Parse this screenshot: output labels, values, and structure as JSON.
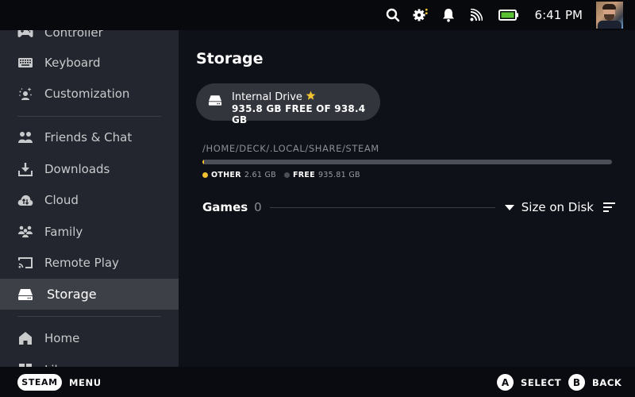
{
  "topbar": {
    "icons": [
      "search-icon",
      "settings-icon",
      "notifications-bell-icon",
      "network-signal-icon",
      "battery-icon"
    ],
    "time": "6:41 PM",
    "battery_level_percent": 100,
    "colors": {
      "battery": "#5bc236",
      "settings_badge": "#f1c232"
    }
  },
  "sidebar": {
    "items": [
      {
        "label": "Controller",
        "icon": "controller-icon"
      },
      {
        "label": "Keyboard",
        "icon": "keyboard-icon"
      },
      {
        "label": "Customization",
        "icon": "customization-icon"
      },
      {
        "label": "Friends & Chat",
        "icon": "friends-icon"
      },
      {
        "label": "Downloads",
        "icon": "download-icon"
      },
      {
        "label": "Cloud",
        "icon": "cloud-icon"
      },
      {
        "label": "Family",
        "icon": "family-icon"
      },
      {
        "label": "Remote Play",
        "icon": "remote-play-icon"
      },
      {
        "label": "Storage",
        "icon": "storage-drive-icon",
        "active": true
      },
      {
        "label": "Home",
        "icon": "home-icon"
      },
      {
        "label": "Library",
        "icon": "library-icon"
      }
    ]
  },
  "main": {
    "title": "Storage",
    "drive": {
      "name": "Internal Drive",
      "default_star": true,
      "free_text": "935.8 GB FREE OF 938.4 GB"
    },
    "path": "/HOME/DECK/.LOCAL/SHARE/STEAM",
    "usage": {
      "total_gb": 938.42,
      "segments": [
        {
          "name": "OTHER",
          "value_label": "2.61 GB",
          "value_gb": 2.61,
          "color": "#f1c232"
        },
        {
          "name": "FREE",
          "value_label": "935.81 GB",
          "value_gb": 935.81,
          "color": "#4b4e56"
        }
      ]
    },
    "games": {
      "label": "Games",
      "count": "0",
      "sort_label": "Size on Disk"
    }
  },
  "bottombar": {
    "steam_label": "STEAM",
    "menu_label": "MENU",
    "hints": [
      {
        "button": "A",
        "label": "SELECT"
      },
      {
        "button": "B",
        "label": "BACK"
      }
    ]
  }
}
